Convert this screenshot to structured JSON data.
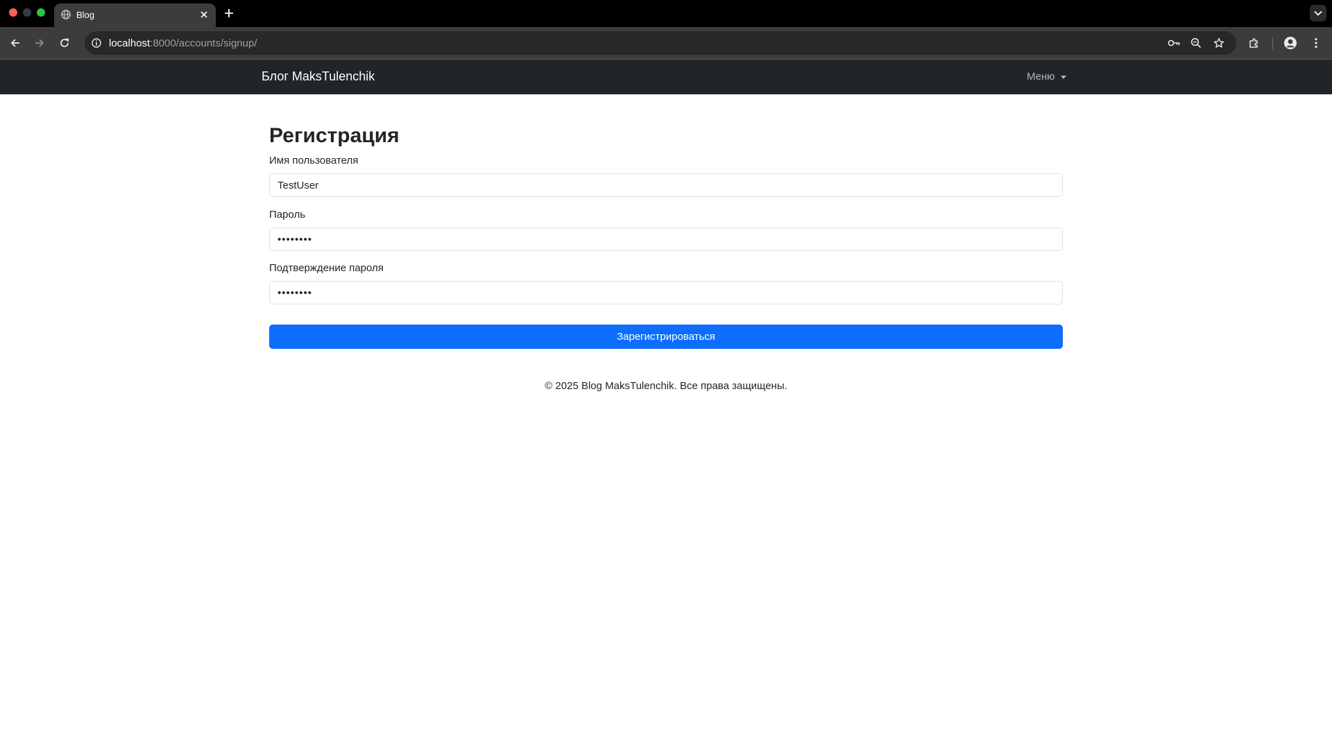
{
  "browser": {
    "tab_title": "Blog",
    "url_host": "localhost",
    "url_rest": ":8000/accounts/signup/",
    "icons": [
      "globe-icon",
      "close-icon",
      "plus-icon",
      "chevron-down-icon",
      "back-icon",
      "forward-icon",
      "reload-icon",
      "info-icon",
      "key-icon",
      "zoom-icon",
      "star-icon",
      "extensions-icon",
      "profile-icon",
      "more-icon"
    ]
  },
  "navbar": {
    "brand": "Блог MaksTulenchik",
    "menu_label": "Меню"
  },
  "form": {
    "title": "Регистрация",
    "username_label": "Имя пользователя",
    "username_value": "TestUser",
    "password_label": "Пароль",
    "password_value": "12345678",
    "confirm_label": "Подтверждение пароля",
    "confirm_value": "12345678",
    "submit_label": "Зарегистрироваться"
  },
  "footer": {
    "text": "© 2025 Blog MaksTulenchik. Все права защищены."
  },
  "colors": {
    "navbar_bg": "#212529",
    "primary": "#0d6efd",
    "chrome_bg": "#3c3c3c"
  }
}
